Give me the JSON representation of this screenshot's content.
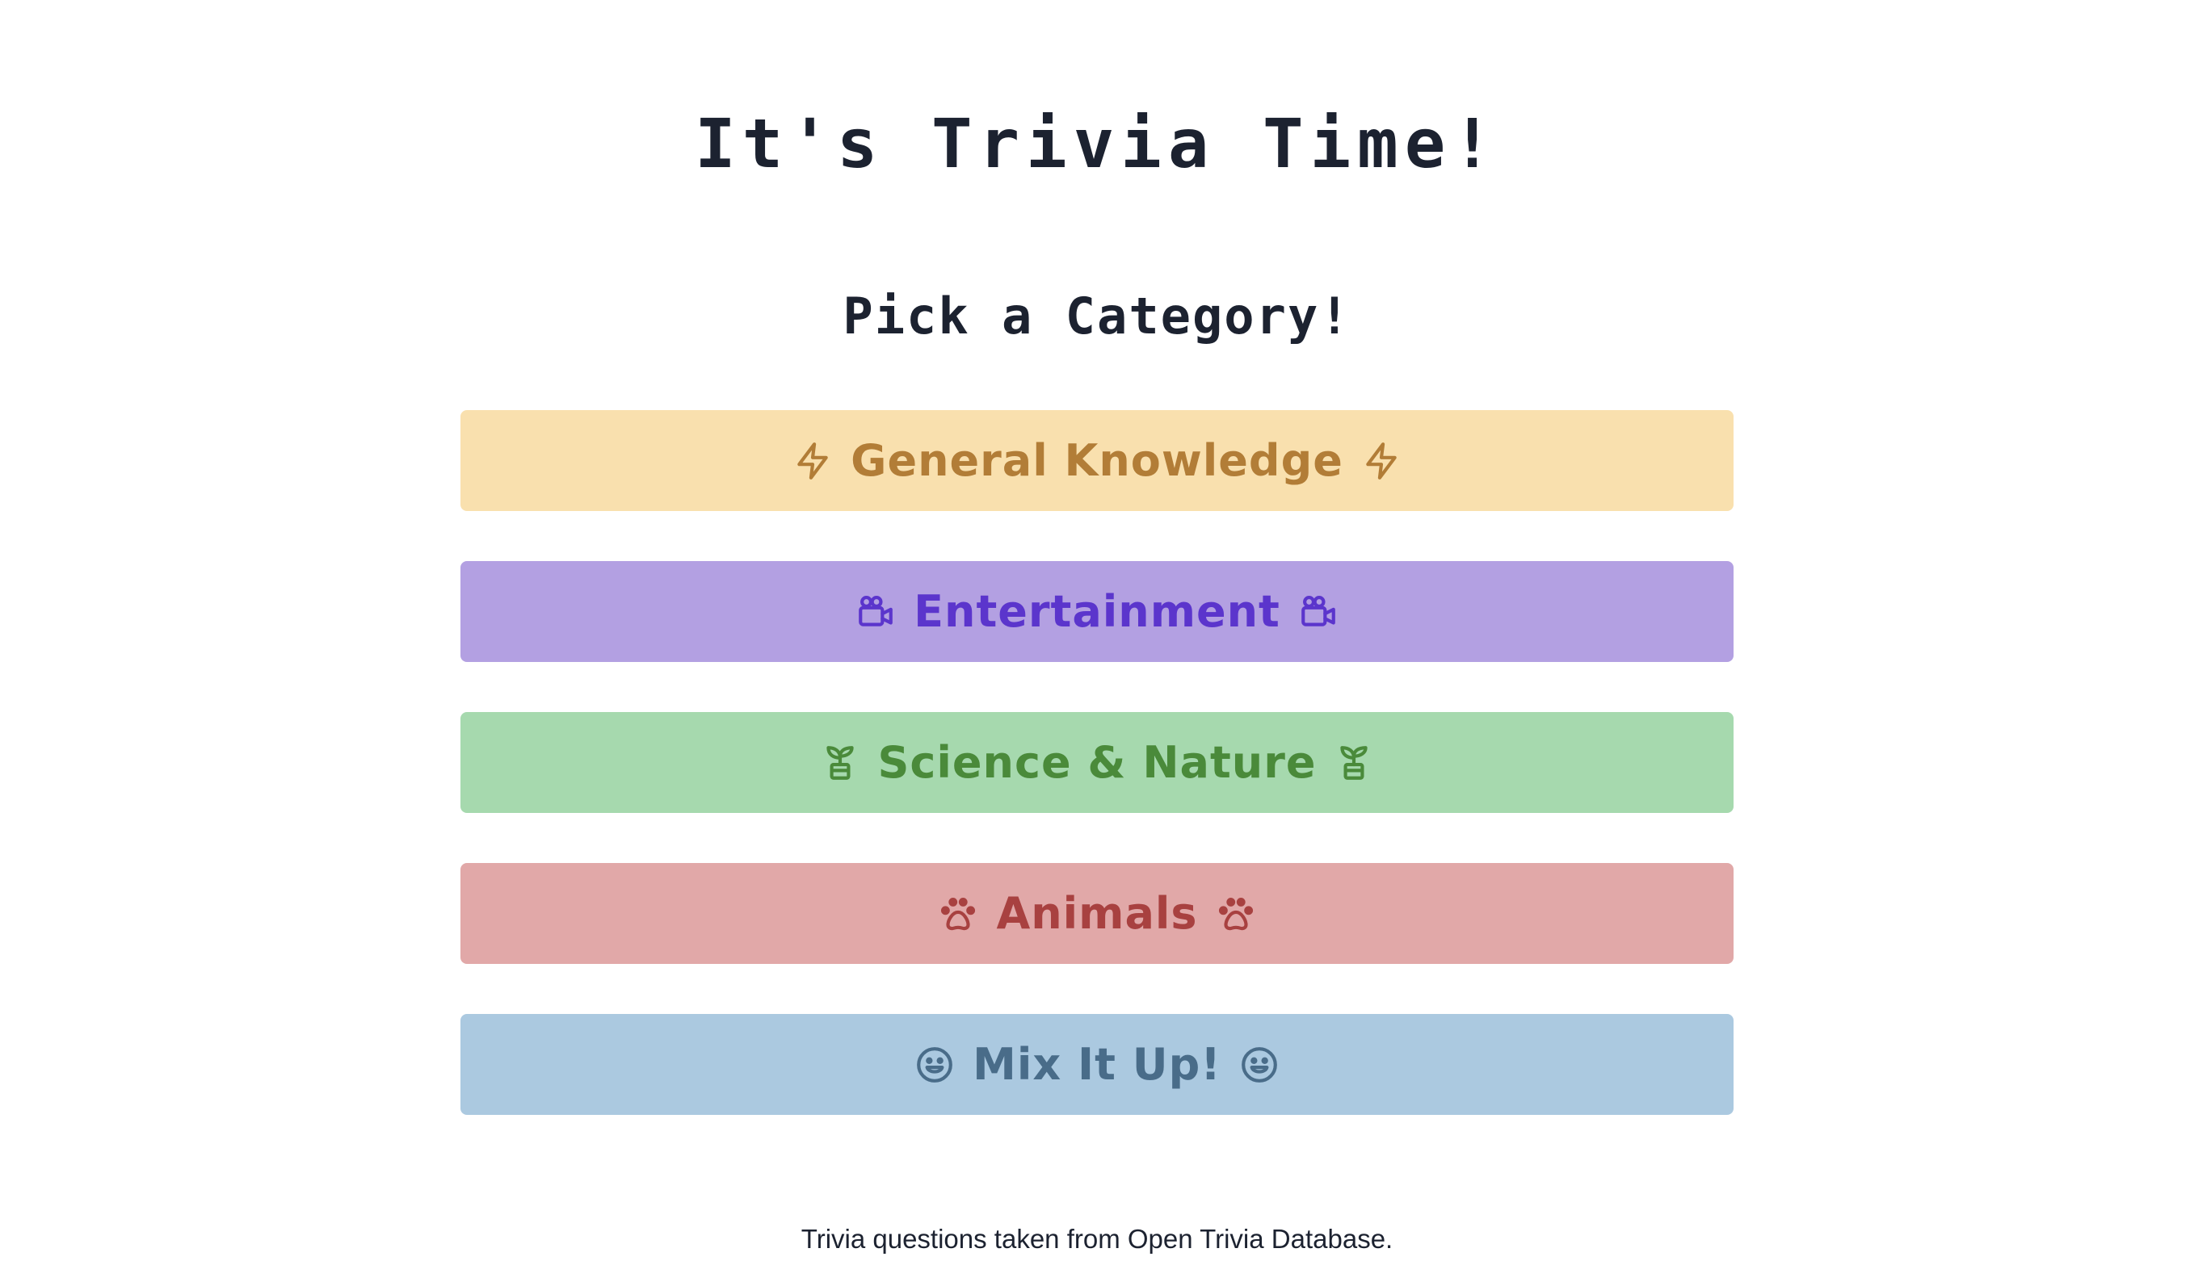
{
  "header": {
    "title": "It's Trivia Time!",
    "subtitle": "Pick a Category!"
  },
  "categories": [
    {
      "label": "General Knowledge",
      "icon": "lightning-bolt-icon",
      "background": "#f9e0ae",
      "color": "#b27d37"
    },
    {
      "label": "Entertainment",
      "icon": "video-camera-icon",
      "background": "#b3a0e2",
      "color": "#5b35cc"
    },
    {
      "label": "Science & Nature",
      "icon": "plant-icon",
      "background": "#a6d9ae",
      "color": "#4a8a3a"
    },
    {
      "label": "Animals",
      "icon": "paw-icon",
      "background": "#e1a8a8",
      "color": "#a84140"
    },
    {
      "label": "Mix It Up!",
      "icon": "smiley-icon",
      "background": "#abc9e0",
      "color": "#496c89"
    }
  ],
  "footer": {
    "text_prefix": "Trivia questions taken from ",
    "link_label": "Open Trivia Database",
    "text_suffix": "."
  }
}
